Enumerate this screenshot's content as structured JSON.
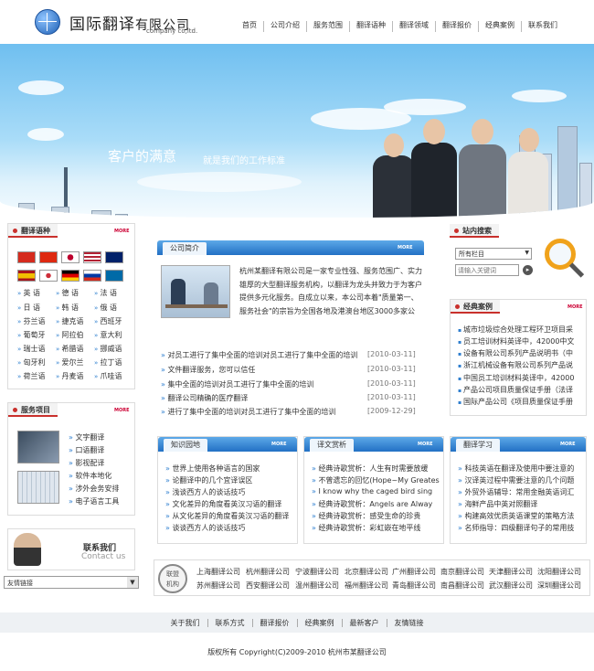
{
  "brand": {
    "name_cn": "国际翻译",
    "name_suffix": "有限公司",
    "name_en": "company co,ltd."
  },
  "nav": [
    "首页",
    "公司介绍",
    "服务范围",
    "翻译语种",
    "翻译领域",
    "翻译报价",
    "经典案例",
    "联系我们"
  ],
  "banner": {
    "slogan_main": "客户的满意",
    "slogan_sub": "就是我们的工作标准"
  },
  "languages": {
    "title": "翻译语种",
    "more": "MORE",
    "items": [
      "英 语",
      "德 语",
      "法 语",
      "日 语",
      "韩 语",
      "俄 语",
      "芬兰语",
      "捷克语",
      "西班牙",
      "葡萄牙",
      "阿拉伯",
      "意大利",
      "瑞士语",
      "希腊语",
      "挪威语",
      "匈牙利",
      "爱尔兰",
      "拉丁语",
      "荷兰语",
      "丹麦语",
      "爪哇语"
    ]
  },
  "services": {
    "title": "服务项目",
    "more": "MORE",
    "items": [
      "文字翻译",
      "口语翻译",
      "影视配译",
      "软件本地化",
      "涉外会务安排",
      "电子语言工具"
    ]
  },
  "contact": {
    "label_cn": "联系我们",
    "label_en": "Contact us"
  },
  "friend_links": {
    "label": "友情链接"
  },
  "intro": {
    "tab": "公司简介",
    "more": "MORE",
    "text": "杭州某翻译有限公司是一家专业性强、服务范围广、实力雄厚的大型翻译服务机构，以翻译为龙头并致力于为客户提供多元化服务。自成立以来，本公司本着\"质量第一、服务社会\"的宗旨为全国各地及港澳台地区3000多家公"
  },
  "news": [
    {
      "title": "对员工进行了集中全面的培训对员工进行了集中全面的培训",
      "date": "[2010-03-11]"
    },
    {
      "title": "文件翻译服务，您可以信任",
      "date": "[2010-03-11]"
    },
    {
      "title": "集中全面的培训对员工进行了集中全面的培训",
      "date": "[2010-03-11]"
    },
    {
      "title": "翻译公司精确的医疗翻译",
      "date": "[2010-03-11]"
    },
    {
      "title": "进行了集中全面的培训对员工进行了集中全面的培训",
      "date": "[2009-12-29]"
    }
  ],
  "search": {
    "title": "站内搜索",
    "select": "所有栏目",
    "placeholder": "请输入关键词"
  },
  "cases": {
    "title": "经典案例",
    "more": "MORE",
    "items": [
      "城市垃圾综合处理工程环卫项目采",
      "员工培训材料英译中，42000中文",
      "设备有限公司系列产品说明书（中",
      "浙江机械设备有限公司系列产品说",
      "中国员工培训材料英译中，42000",
      "产品公司项目质量保证手册（法译",
      "国际产品公司《项目质量保证手册"
    ]
  },
  "knowledge": {
    "title": "知识园地",
    "more": "MORE",
    "items": [
      "世界上使用各种语言的国家",
      "论翻译中的几个宜译误区",
      "浅谈西方人的谈话技巧",
      "文化差异的角度看英汉习语的翻译",
      "从文化差异的角度看英汉习语的翻译",
      "谈谈西方人的谈话技巧"
    ]
  },
  "appreciation": {
    "title": "译文赏析",
    "more": "MORE",
    "items": [
      "经典诗歌赏析：人生有时需要放缓",
      "不曾遗忘的回忆(Hope~My Greates",
      "I know why the caged bird sing",
      "经典诗歌赏析：Angels are Alway",
      "经典诗歌赏析：感受生命的珍贵",
      "经典诗歌赏析：彩虹嵌在地平线"
    ]
  },
  "learning": {
    "title": "翻译学习",
    "more": "MORE",
    "items": [
      "科技英语在翻译及使用中要注意的",
      "汉译英过程中需要注意的几个问题",
      "外贸外语辅导：常用金融英语词汇",
      "海鲜产品中英对照翻译",
      "构建高效优质英语课堂的策略方法",
      "名师指导：四级翻译句子的常用技"
    ]
  },
  "alliance": {
    "badge_top": "联盟",
    "badge_bottom": "机构",
    "row1": [
      "上海翻译公司",
      "杭州翻译公司",
      "宁波翻译公司",
      "北京翻译公司",
      "广州翻译公司",
      "南京翻译公司",
      "天津翻译公司",
      "沈阳翻译公司"
    ],
    "row2": [
      "苏州翻译公司",
      "西安翻译公司",
      "温州翻译公司",
      "福州翻译公司",
      "青岛翻译公司",
      "南昌翻译公司",
      "武汉翻译公司",
      "深圳翻译公司"
    ]
  },
  "footer": {
    "links": [
      "关于我们",
      "联系方式",
      "翻译报价",
      "经典案例",
      "最新客户",
      "友情链接"
    ],
    "copyright": "版权所有 Copyright(C)2009-2010 杭州市某翻译公司"
  },
  "colors": {
    "accent_blue": "#2270c4",
    "accent_red": "#c9302c"
  }
}
